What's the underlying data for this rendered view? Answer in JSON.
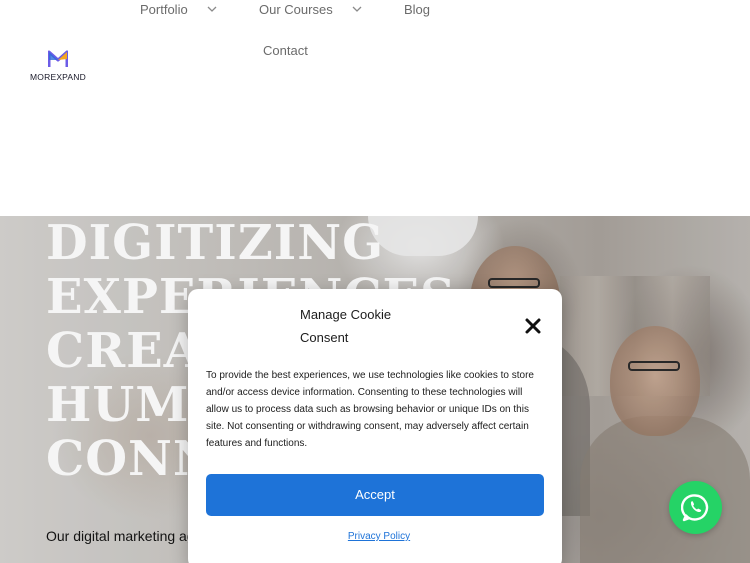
{
  "brand": {
    "name": "MOREXPAND",
    "logo_colors": [
      "#6c5ce7",
      "#f5a623",
      "#2d6bd8"
    ]
  },
  "nav": {
    "items": [
      {
        "label": "Portfolio",
        "has_dropdown": true
      },
      {
        "label": "Our Courses",
        "has_dropdown": true
      },
      {
        "label": "Blog",
        "has_dropdown": false
      },
      {
        "label": "Contact",
        "has_dropdown": false
      }
    ]
  },
  "hero": {
    "title_lines": [
      "DIGITIZING",
      "EXPERIENCES",
      "CREATING",
      "HUMAN",
      "CONNECTIONS"
    ],
    "copy": "Our digital marketing agency services get your business"
  },
  "cookie_modal": {
    "title": "Manage Cookie Consent",
    "body": "To provide the best experiences, we use technologies like cookies to store and/or access device information. Consenting to these technologies will allow us to process data such as browsing behavior or unique IDs on this site. Not consenting or withdrawing consent, may adversely affect certain features and functions.",
    "accept_label": "Accept",
    "privacy_label": "Privacy Policy",
    "accent": "#1e73d8"
  },
  "whatsapp": {
    "icon": "whatsapp-icon",
    "color": "#25d366"
  }
}
